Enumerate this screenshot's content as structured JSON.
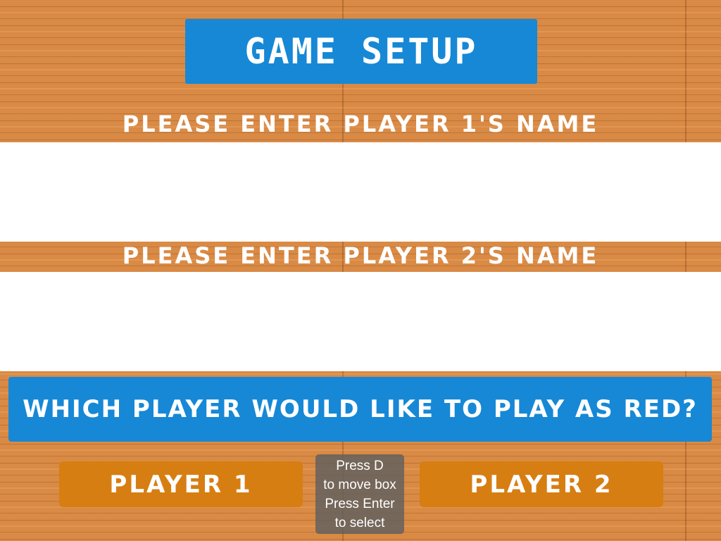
{
  "title": "GAME SETUP",
  "player1_prompt": "PLEASE ENTER PLAYER 1'S NAME",
  "player1_name": "",
  "player2_prompt": "PLEASE ENTER PLAYER 2'S NAME",
  "player2_name": "",
  "question": "WHICH PLAYER WOULD LIKE TO PLAY AS RED?",
  "buttons": {
    "player1": "PLAYER 1",
    "player2": "PLAYER 2"
  },
  "hint": {
    "line1": "Press D",
    "line2": "to move box",
    "line3": "Press Enter",
    "line4": "to select"
  },
  "colors": {
    "wood": "#d98a45",
    "title_box": "#1688d6",
    "player_button": "#d77e12",
    "hint_box": "#5f5f5f"
  }
}
